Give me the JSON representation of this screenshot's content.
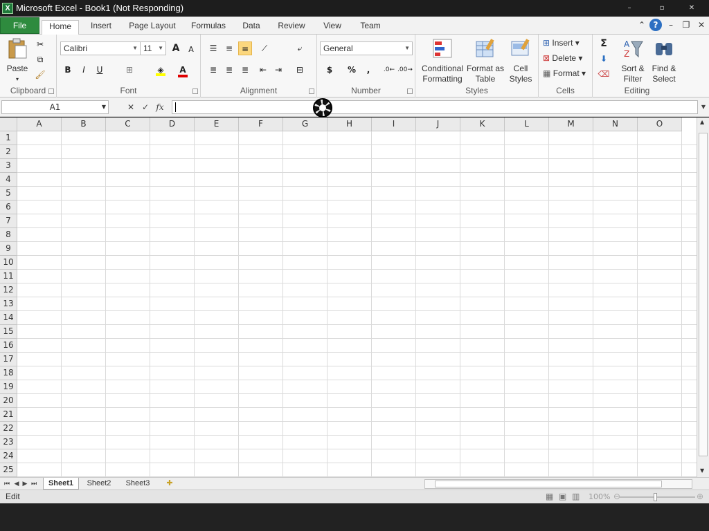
{
  "window": {
    "title": "Microsoft Excel - Book1 (Not Responding)",
    "app_icon": "X",
    "controls": [
      "–",
      "▫",
      "✕"
    ]
  },
  "tabs": [
    "File",
    "Home",
    "Insert",
    "Page Layout",
    "Formulas",
    "Data",
    "Review",
    "View",
    "Team"
  ],
  "ribbon": {
    "clipboard": {
      "label": "Clipboard",
      "paste": "Paste"
    },
    "font": {
      "label": "Font",
      "family": "Calibri",
      "size": "11",
      "bold": "B",
      "italic": "I",
      "underline": "U",
      "grow": "A",
      "shrink": "A"
    },
    "alignment": {
      "label": "Alignment"
    },
    "number": {
      "label": "Number",
      "format": "General",
      "currency": "$",
      "percent": "%",
      "comma": ","
    },
    "styles": {
      "label": "Styles",
      "conditional": [
        "Conditional",
        "Formatting"
      ],
      "format_table": [
        "Format as",
        "Table"
      ],
      "cell_styles": [
        "Cell",
        "Styles"
      ]
    },
    "cells": {
      "label": "Cells",
      "insert": "Insert",
      "delete": "Delete",
      "format": "Format"
    },
    "editing": {
      "label": "Editing",
      "sigma": "Σ",
      "sort_filter": [
        "Sort &",
        "Filter"
      ],
      "find_select": [
        "Find &",
        "Select"
      ]
    }
  },
  "formula_bar": {
    "name_box": "A1",
    "fx": "fx",
    "cancel": "✕",
    "enter": "✓",
    "value": ""
  },
  "grid": {
    "columns": [
      "A",
      "B",
      "C",
      "D",
      "E",
      "F",
      "G",
      "H",
      "I",
      "J",
      "K",
      "L",
      "M",
      "N",
      "O"
    ],
    "rows": [
      "1",
      "2",
      "3",
      "4",
      "5",
      "6",
      "7",
      "8",
      "9",
      "10",
      "11",
      "12",
      "13",
      "14",
      "15",
      "16",
      "17",
      "18",
      "19",
      "20",
      "21",
      "22",
      "23",
      "24",
      "25"
    ]
  },
  "sheets": [
    "Sheet1",
    "Sheet2",
    "Sheet3"
  ],
  "status": {
    "mode": "Edit",
    "zoom": "100%"
  },
  "colors": {
    "file_tab": "#2e8b3e",
    "title_bar": "#1d1d1d"
  }
}
